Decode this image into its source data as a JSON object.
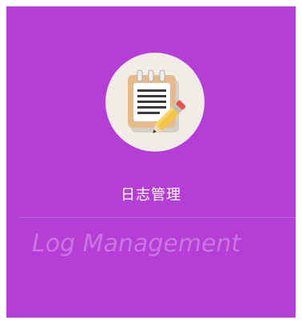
{
  "tile": {
    "title": "日志管理",
    "subtitle": "Log Management",
    "icon": "notepad-pencil-icon",
    "background_color": "#b53fd6"
  }
}
